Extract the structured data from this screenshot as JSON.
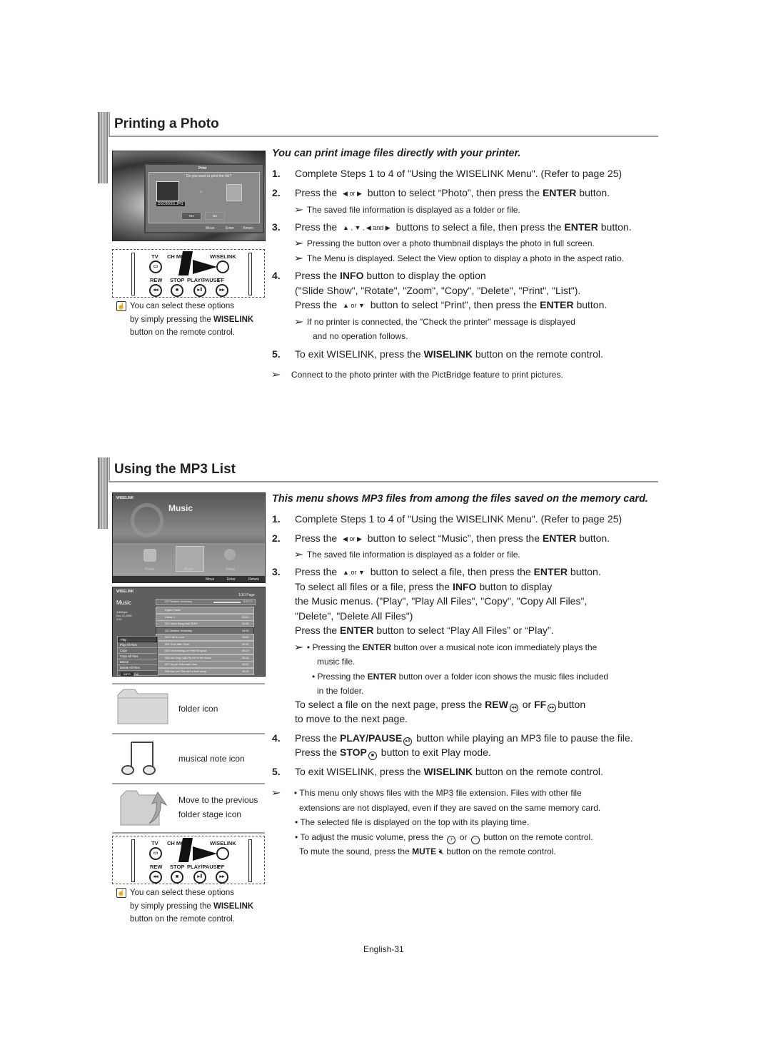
{
  "page_number": "English-31",
  "section1": {
    "title": "Printing a Photo",
    "subtitle": "You can print image files directly with your printer.",
    "screenshot": {
      "dialog_title": "Print",
      "question": "Do you want to print the file?",
      "filename": "DSC00001.JPG",
      "yes": "Yes",
      "no": "No",
      "footer": [
        "Move",
        "Enter",
        "Return"
      ]
    },
    "steps": [
      {
        "num": "1.",
        "pre": "Complete Steps 1 to 4 of \"Using the WISELINK Menu\". (Refer to page 25)"
      },
      {
        "num": "2.",
        "pre": "Press the",
        "arrows": "◀ or ▶",
        "mid": "button to select “Photo”, then press the",
        "bold": "ENTER",
        "post": "button."
      },
      {
        "num": "3.",
        "pre": "Press the",
        "arrows": "▲ , ▼ , ◀ and ▶",
        "mid": "buttons to select a file, then press the",
        "bold": "ENTER",
        "post": "button."
      },
      {
        "num": "4.",
        "pre": "Press the",
        "bold": "INFO",
        "post": "button to display the option"
      },
      {
        "num": "5.",
        "pre": "To exit WISELINK, press the",
        "bold": "WISELINK",
        "post": "button on the remote control."
      }
    ],
    "step2_note": "The saved file information is displayed as a folder or file.",
    "step3_notes": [
      "Pressing the button over a photo thumbnail displays the photo in full screen.",
      "The Menu is displayed. Select the View option to display a photo in the aspect ratio."
    ],
    "step4_line2": "(\"Slide Show\", \"Rotate\", \"Zoom\", \"Copy\", \"Delete\", \"Print\", \"List\").",
    "step4_line3": {
      "pre": "Press the",
      "arrows": "▲ or ▼",
      "mid": "button to select “Print”, then press the",
      "bold": "ENTER",
      "post": "button."
    },
    "step4_note": [
      "If no printer is connected, the \"Check the printer\" message is displayed",
      "and no operation follows."
    ],
    "final_note": "Connect to the photo printer with the PictBridge feature to print pictures."
  },
  "remote": {
    "labels": [
      "TV",
      "CH MGR",
      "WISELINK",
      "REW",
      "STOP",
      "PLAY/PAUSE",
      "FF"
    ],
    "hint": [
      "You can select these options",
      "by simply pressing the",
      "WISELINK",
      "button on the remote control."
    ]
  },
  "section2": {
    "title": "Using the MP3 List",
    "subtitle": "This menu shows MP3 files from among the files saved on the memory card.",
    "main_screen": {
      "brand": "WISELINK",
      "title": "Music",
      "items": [
        "Photo",
        "Music",
        "Setup"
      ],
      "footer": [
        "Move",
        "Enter",
        "Return"
      ]
    },
    "list_screen": {
      "brand": "WISELINK",
      "title": "Music",
      "page": "1/10 Page",
      "info": [
        "4.8Mbyte",
        "Nov 21,2006",
        "2/10"
      ],
      "now_playing": "002 Beatles-Yesterday",
      "now_time": "0:00:27",
      "rows": [
        {
          "name": "Upper Folder",
          "time": ""
        },
        {
          "name": "Folder 1",
          "time": "03:40"
        },
        {
          "name": "001 Open Song-Nah TENY",
          "time": "04:55"
        },
        {
          "name": "002 Beatles-Yesterday",
          "time": "04:25"
        },
        {
          "name": "003 Fall In Love",
          "time": "03:50"
        },
        {
          "name": "004 Time After Time",
          "time": "03:50"
        },
        {
          "name": "005 Chub Mang-Lim Feel So good",
          "time": "05:10"
        },
        {
          "name": "006 Hot Sing Cath Fly me to the moon",
          "time": "05:10"
        },
        {
          "name": "007 Hy-teh Saturnate Hare",
          "time": "03:30"
        },
        {
          "name": "008 Bon jovi This ain't a love song",
          "time": "05:10"
        }
      ],
      "menu": [
        "Play",
        "Play All Files",
        "Copy",
        "Copy All Files",
        "Delete",
        "Delete All Files"
      ],
      "exit": "Exit"
    },
    "icon_legend": [
      {
        "icon": "folder-icon",
        "label": "folder icon"
      },
      {
        "icon": "musical-note-icon",
        "label": "musical note icon"
      },
      {
        "icon": "previous-folder-icon",
        "label": [
          "Move to the previous",
          "folder stage icon"
        ]
      }
    ],
    "steps": [
      {
        "num": "1.",
        "pre": "Complete Steps 1 to 4 of \"Using the WISELINK Menu\". (Refer to page 25)"
      },
      {
        "num": "2.",
        "pre": "Press the",
        "arrows": "◀ or ▶",
        "mid": "button to select “Music”, then press the",
        "bold": "ENTER",
        "post": "button."
      },
      {
        "num": "3.",
        "pre": "Press the",
        "arrows": "▲ or ▼",
        "mid": "button to select a file, then press the",
        "bold": "ENTER",
        "post": "button."
      },
      {
        "num": "4.",
        "pre": "Press the",
        "bold": "PLAY/PAUSE",
        "post": "button while playing an MP3 file to pause the file."
      },
      {
        "num": "5.",
        "pre": "To exit WISELINK, press the",
        "bold": "WISELINK",
        "post": "button on the remote control."
      }
    ],
    "step2_note": "The saved file information is displayed as a folder or file.",
    "step3_lines": {
      "l2_pre": "To select all files or a file, press the",
      "l2_bold": "INFO",
      "l2_post": "button to display",
      "l3": "the Music menus. (\"Play\", \"Play All Files\", \"Copy\", \"Copy All Files\",",
      "l4": "\"Delete\", \"Delete All Files\")",
      "l5_pre": "Press the",
      "l5_bold": "ENTER",
      "l5_post": "button to select “Play All Files” or “Play”."
    },
    "step3_notes": [
      {
        "pre": "• Pressing the",
        "bold": "ENTER",
        "post": "button over a musical note icon immediately plays the",
        "cont": "music file."
      },
      {
        "pre": "• Pressing the",
        "bold": "ENTER",
        "post": "button over a folder icon shows the music files included",
        "cont": "in the folder."
      }
    ],
    "step3_next_page": {
      "pre": "To select a file on the next page, press the",
      "b1": "REW",
      "or": "or",
      "b2": "FF",
      "post": "button",
      "line2": "to move to the next page."
    },
    "step4_line2": {
      "pre": "Press the",
      "bold": "STOP",
      "post": "button to exit Play mode."
    },
    "final_notes": {
      "n1": "• This menu only shows files with the MP3 file extension. Files with other file",
      "n1b": "extensions are not displayed, even if they are saved on the same memory card.",
      "n2": "• The selected file is displayed on the top with its playing time.",
      "n3_pre": "• To adjust the music volume, press the",
      "n3_or": "or",
      "n3_post": "button on the remote control.",
      "n4_pre": "To mute the sound, press the",
      "n4_bold": "MUTE",
      "n4_post": "button on the remote control."
    }
  }
}
